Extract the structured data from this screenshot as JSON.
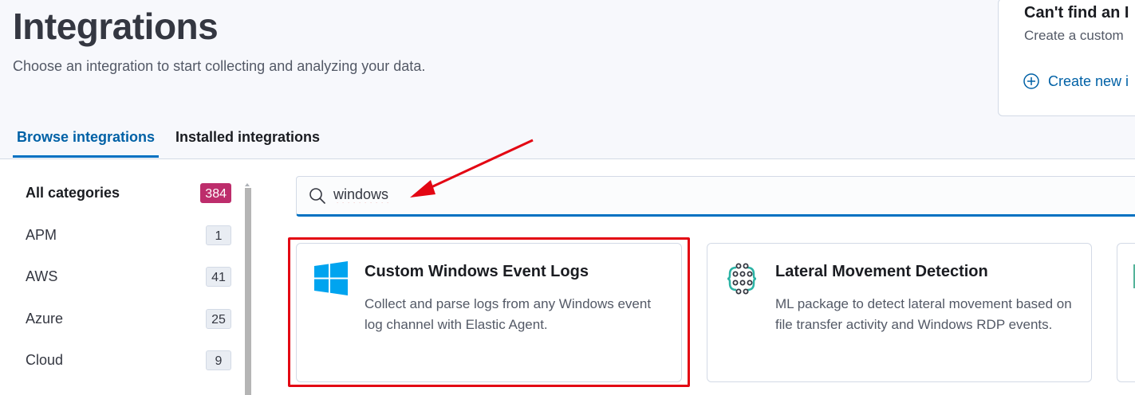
{
  "header": {
    "title": "Integrations",
    "subtitle": "Choose an integration to start collecting and analyzing your data."
  },
  "cta": {
    "title": "Can't find an I",
    "description": "Create a custom",
    "link_label": "Create new i"
  },
  "tabs": [
    {
      "label": "Browse integrations",
      "active": true
    },
    {
      "label": "Installed integrations",
      "active": false
    }
  ],
  "sidebar": {
    "categories": [
      {
        "label": "All categories",
        "count": "384",
        "active": true
      },
      {
        "label": "APM",
        "count": "1"
      },
      {
        "label": "AWS",
        "count": "41"
      },
      {
        "label": "Azure",
        "count": "25"
      },
      {
        "label": "Cloud",
        "count": "9"
      }
    ]
  },
  "search": {
    "value": "windows",
    "icon": "search-icon"
  },
  "cards": [
    {
      "title": "Custom Windows Event Logs",
      "description": "Collect and parse logs from any Windows event log channel with Elastic Agent.",
      "icon": "windows-logo-icon"
    },
    {
      "title": "Lateral Movement Detection",
      "description": "ML package to detect lateral movement based on file transfer activity and Windows RDP events.",
      "icon": "ml-package-icon"
    }
  ],
  "colors": {
    "accent": "#0071c2",
    "link": "#0061a6",
    "badge_active": "#bd2d6c",
    "annotation_red": "#e30613",
    "windows_blue": "#00a4ef"
  }
}
